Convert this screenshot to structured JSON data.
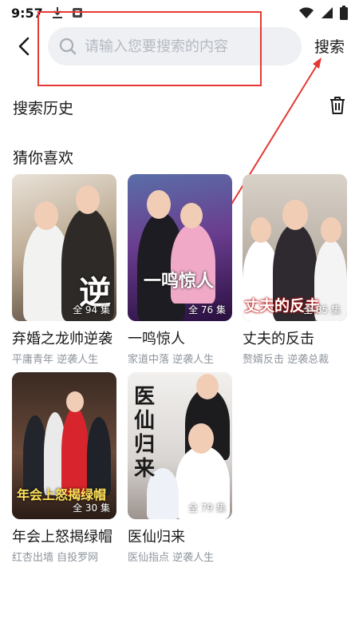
{
  "status_bar": {
    "time": "9:57"
  },
  "header": {
    "search_placeholder": "请输入您要搜索的内容",
    "search_label": "搜索"
  },
  "sections": {
    "history_title": "搜索历史",
    "guess_title": "猜你喜欢"
  },
  "cards": [
    {
      "title": "弃婚之龙帅逆袭",
      "tags": "平庸青年 逆袭人生",
      "episodes": "全 94 集",
      "poster_text": "逆"
    },
    {
      "title": "一鸣惊人",
      "tags": "家道中落 逆袭人生",
      "episodes": "全 76 集",
      "poster_text": "一鸣惊人"
    },
    {
      "title": "丈夫的反击",
      "tags": "赘婿反击 逆袭总裁",
      "episodes": "全 85 集",
      "poster_text": "丈夫的反击"
    },
    {
      "title": "年会上怒揭绿帽",
      "tags": "红杏出墙 自投罗网",
      "episodes": "全 30 集",
      "poster_text": "年会上怒揭绿帽"
    },
    {
      "title": "医仙归来",
      "tags": "医仙指点 逆袭人生",
      "episodes": "全 79 集",
      "poster_text": "医仙归来"
    }
  ],
  "colors": {
    "annotation": "#e53935",
    "search_bg": "#eef0f3",
    "tag_text": "#8e949c"
  }
}
